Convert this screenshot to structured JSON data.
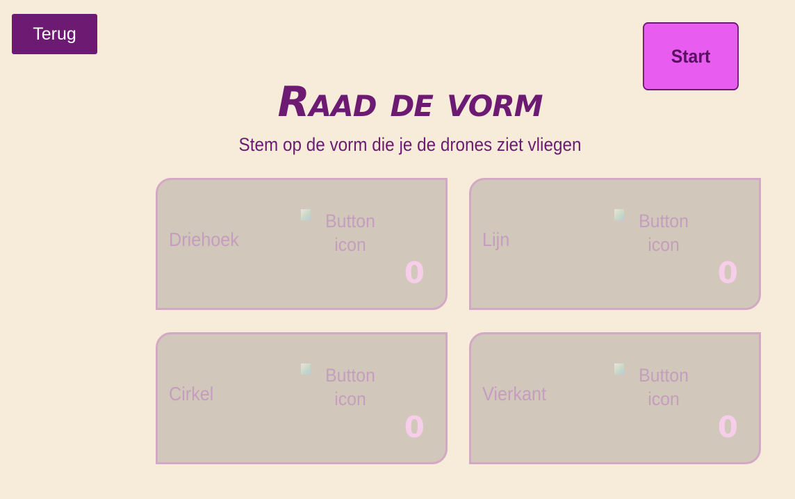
{
  "header": {
    "back_label": "Terug",
    "start_label": "Start",
    "title": "Raad de vorm",
    "subtitle": "Stem op de vorm die je de drones ziet vliegen"
  },
  "options": [
    {
      "label": "Driehoek",
      "icon_alt": "Button icon",
      "count": "0"
    },
    {
      "label": "Lijn",
      "icon_alt": "Button icon",
      "count": "0"
    },
    {
      "label": "Cirkel",
      "icon_alt": "Button icon",
      "count": "0"
    },
    {
      "label": "Vierkant",
      "icon_alt": "Button icon",
      "count": "0"
    }
  ],
  "colors": {
    "background": "#f7ecd9",
    "primary": "#6d1a73",
    "start_button": "#e85cf0",
    "card_background": "#d1c8bb",
    "card_border": "#d3a8c4",
    "card_text": "#c59dbd",
    "count_text": "#f7cee9"
  }
}
